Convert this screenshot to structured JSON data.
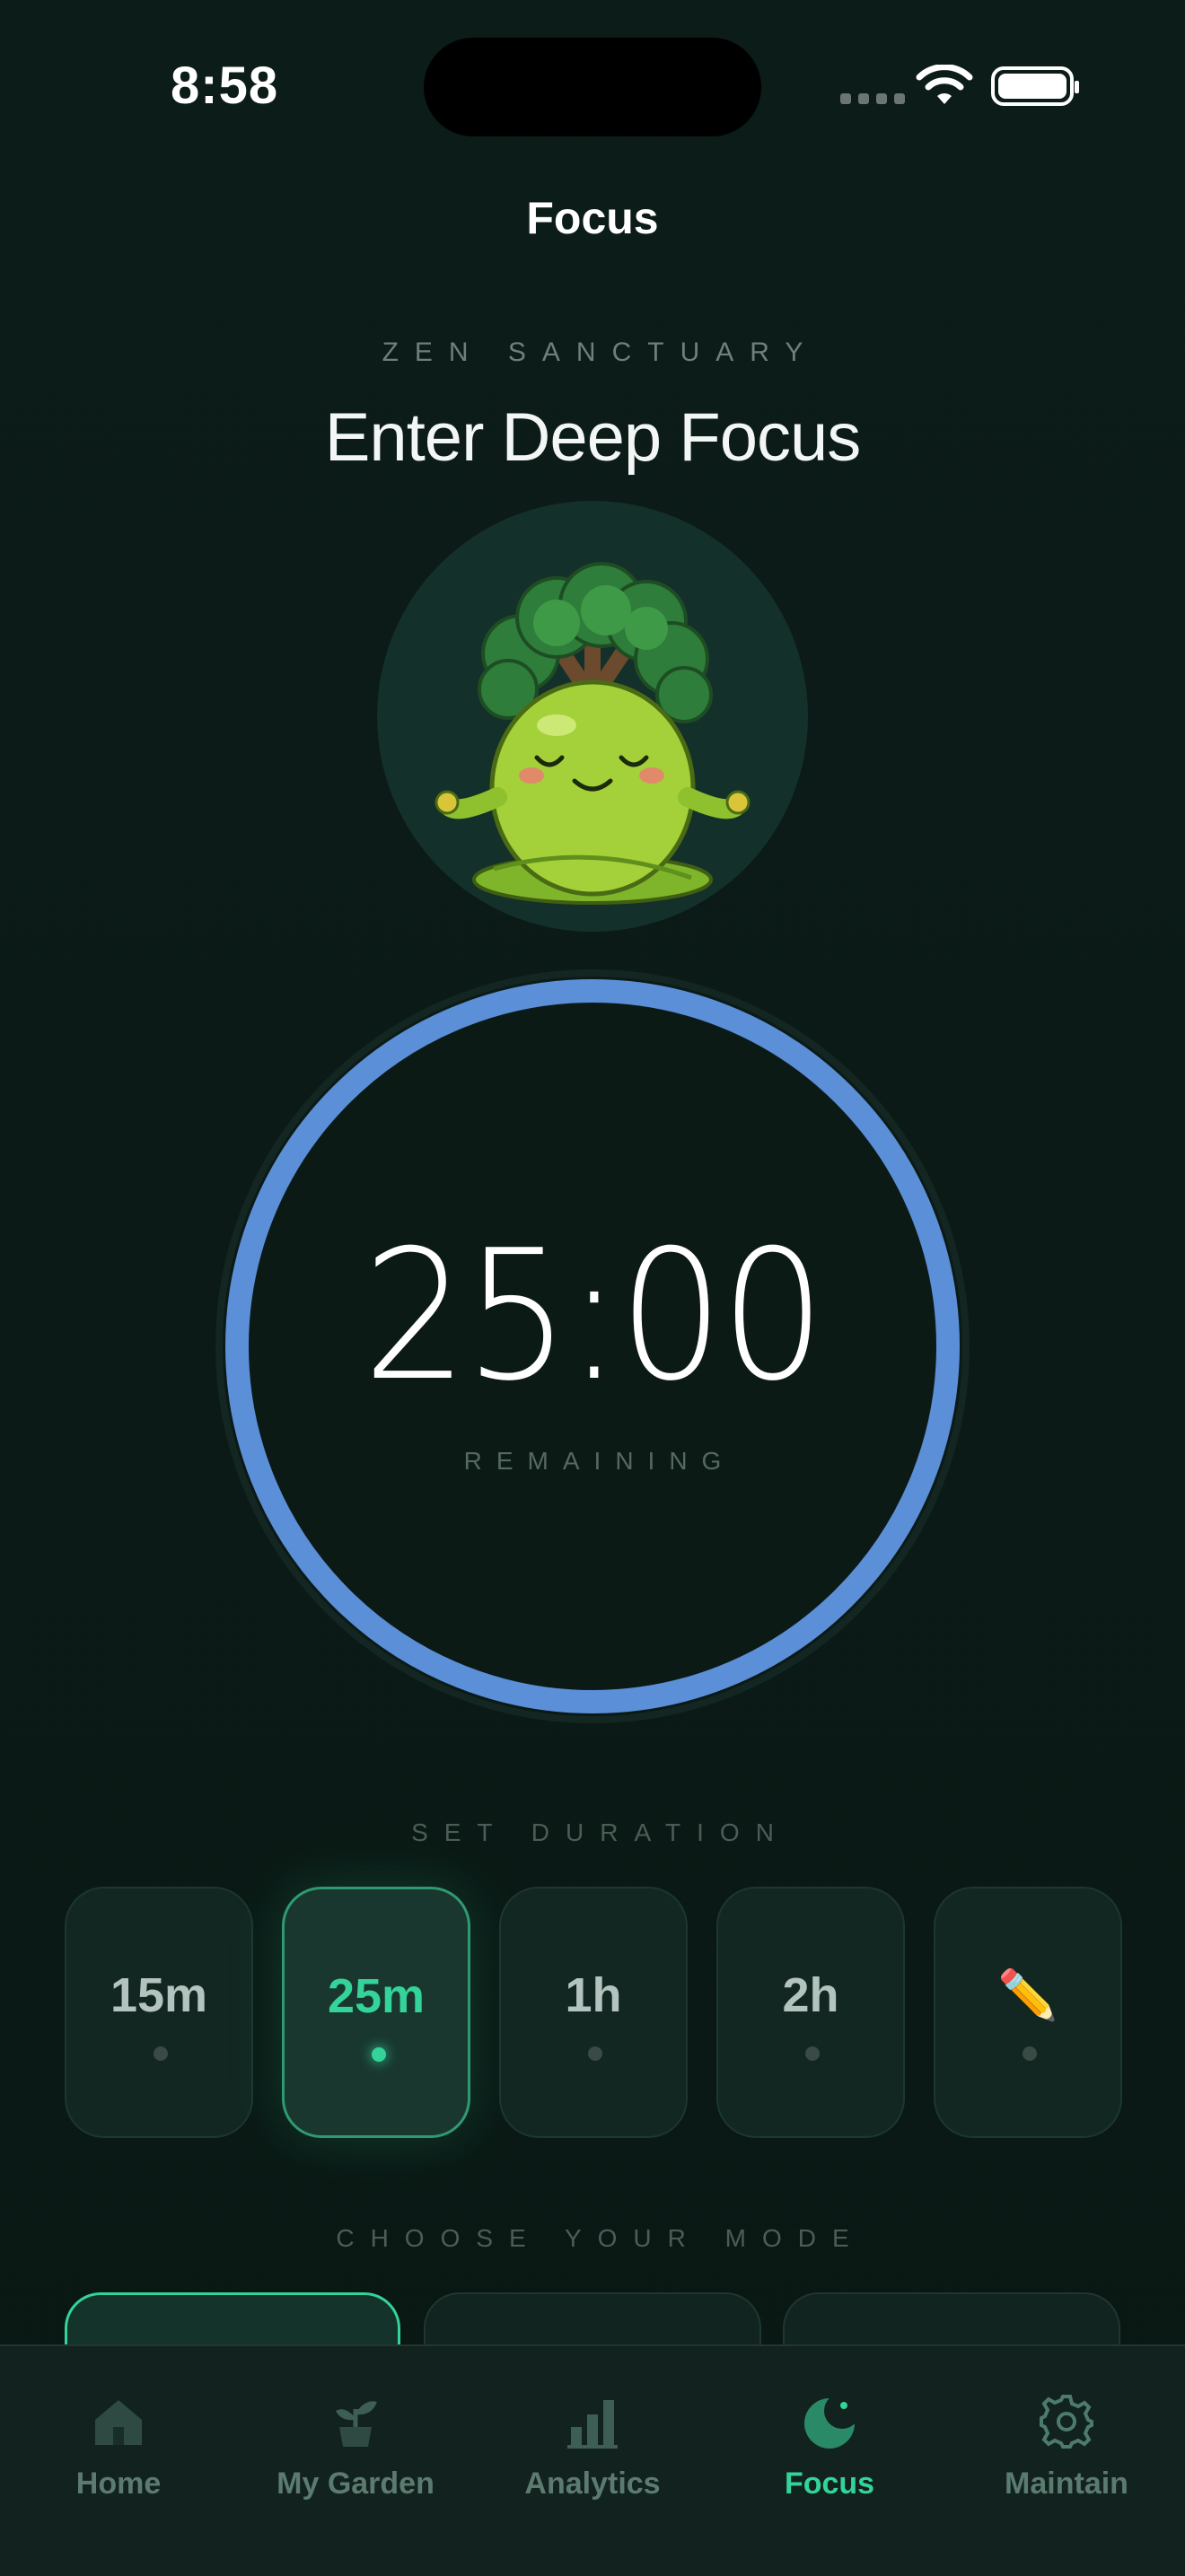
{
  "status_bar": {
    "time": "8:58"
  },
  "header": {
    "title": "Focus"
  },
  "hero": {
    "eyebrow": "ZEN SANCTUARY",
    "headline": "Enter Deep Focus",
    "mascot_icon": "meditating-tree-sprout-icon"
  },
  "timer": {
    "value": "25:00",
    "caption": "REMAINING",
    "ring_color": "#5b8fd8"
  },
  "duration": {
    "label": "SET DURATION",
    "options": [
      {
        "label": "15m",
        "selected": false
      },
      {
        "label": "25m",
        "selected": true
      },
      {
        "label": "1h",
        "selected": false
      },
      {
        "label": "2h",
        "selected": false
      },
      {
        "label": "✏️",
        "selected": false,
        "icon": "pencil-icon"
      }
    ]
  },
  "mode": {
    "label": "CHOOSE YOUR MODE"
  },
  "tab_bar": {
    "items": [
      {
        "label": "Home",
        "icon": "home-icon"
      },
      {
        "label": "My Garden",
        "icon": "sprout-icon"
      },
      {
        "label": "Analytics",
        "icon": "bar-chart-icon"
      },
      {
        "label": "Focus",
        "icon": "moon-icon",
        "active": true
      },
      {
        "label": "Maintain",
        "icon": "gear-icon"
      }
    ]
  },
  "colors": {
    "accent": "#34d399",
    "background": "#0b1a16",
    "ring": "#5b8fd8"
  }
}
